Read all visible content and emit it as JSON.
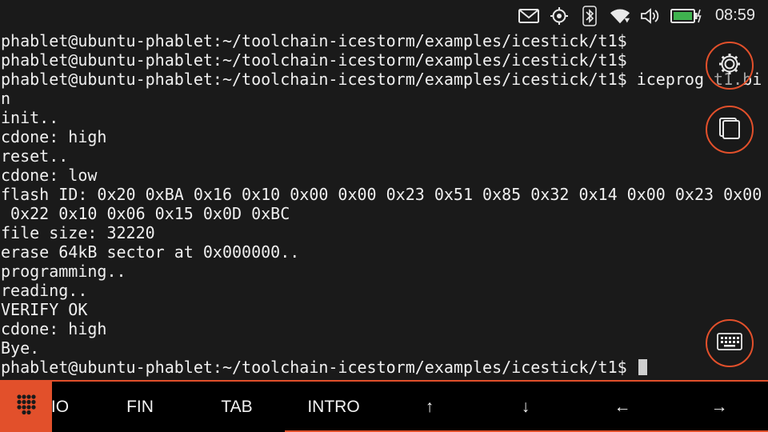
{
  "statusbar": {
    "time": "08:59",
    "icons": [
      "messages-icon",
      "location-icon",
      "bluetooth-icon",
      "wifi-icon",
      "volume-icon",
      "battery-charging-icon"
    ]
  },
  "terminal": {
    "lines": [
      "phablet@ubuntu-phablet:~/toolchain-icestorm/examples/icestick/t1$",
      "phablet@ubuntu-phablet:~/toolchain-icestorm/examples/icestick/t1$",
      "phablet@ubuntu-phablet:~/toolchain-icestorm/examples/icestick/t1$ iceprog t1.bi",
      "n",
      "init..",
      "cdone: high",
      "reset..",
      "cdone: low",
      "flash ID: 0x20 0xBA 0x16 0x10 0x00 0x00 0x23 0x51 0x85 0x32 0x14 0x00 0x23 0x00",
      " 0x22 0x10 0x06 0x15 0x0D 0xBC",
      "file size: 32220",
      "erase 64kB sector at 0x000000..",
      "programming..",
      "reading..",
      "VERIFY OK",
      "cdone: high",
      "Bye.",
      "phablet@ubuntu-phablet:~/toolchain-icestorm/examples/icestick/t1$ "
    ]
  },
  "keybar": {
    "keys": [
      "IO",
      "FIN",
      "TAB",
      "INTRO",
      "↑",
      "↓",
      "←",
      "→"
    ]
  },
  "colors": {
    "accent": "#e2502b",
    "background": "#1a1a1a",
    "keybar_background": "#000000",
    "text": "#f0f0f0"
  }
}
